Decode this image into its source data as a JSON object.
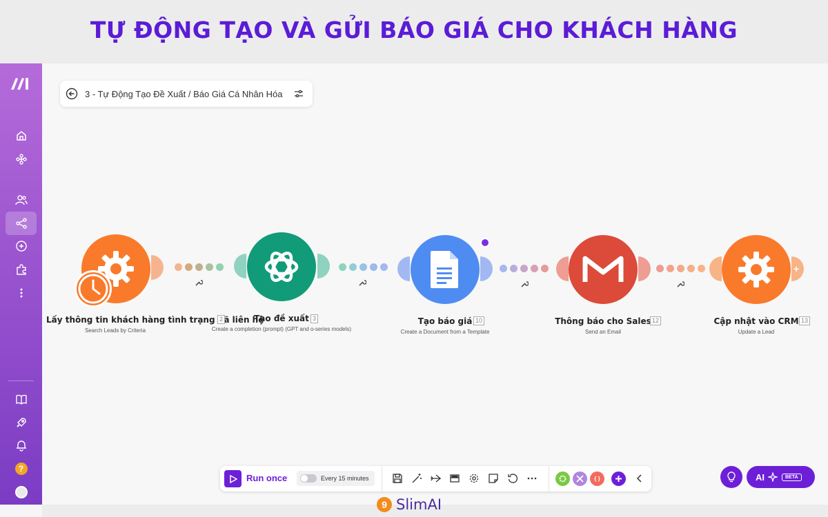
{
  "banner": {
    "title": "TỰ ĐỘNG TẠO VÀ GỬI BÁO GIÁ CHO KHÁCH HÀNG"
  },
  "scenario": {
    "name": "3 - Tự Động Tạo Đề Xuất / Báo Giá Cá Nhân Hóa"
  },
  "sidebar": {
    "logo": "make-logo",
    "items": [
      {
        "icon": "home-icon"
      },
      {
        "icon": "apps-icon"
      },
      {
        "icon": "team-icon"
      },
      {
        "icon": "scenarios-icon",
        "active": true
      },
      {
        "icon": "connections-icon"
      },
      {
        "icon": "puzzle-icon"
      },
      {
        "icon": "more-vertical-icon"
      }
    ],
    "bottom": [
      {
        "icon": "book-icon"
      },
      {
        "icon": "rocket-icon"
      },
      {
        "icon": "bell-icon"
      },
      {
        "icon": "help-icon",
        "text": "?"
      },
      {
        "icon": "avatar"
      }
    ]
  },
  "modules": [
    {
      "title": "Lấy thông tin khách hàng tình trạng đã liên hệ",
      "subtitle": "Search Leads by Criteria",
      "index": "2",
      "color": "#f97a2b",
      "icon": "gear-icon"
    },
    {
      "title": "Tạo đề xuất",
      "subtitle": "Create a completion (prompt) (GPT and o-series models)",
      "index": "3",
      "color": "#129b78",
      "icon": "openai-icon"
    },
    {
      "title": "Tạo báo giá",
      "subtitle": "Create a Document from a Template",
      "index": "10",
      "color": "#4f8cf2",
      "icon": "google-docs-icon"
    },
    {
      "title": "Thông báo cho Sales",
      "subtitle": "Send an Email",
      "index": "12",
      "color": "#dc4a3a",
      "icon": "gmail-icon"
    },
    {
      "title": "Cập nhật vào CRM",
      "subtitle": "Update a Lead",
      "index": "13",
      "color": "#f97a2b",
      "icon": "gear-icon"
    }
  ],
  "toolbar": {
    "run_label": "Run once",
    "schedule_label": "Every 15 minutes",
    "icons": [
      "save-icon",
      "magic-wand-icon",
      "airplane-icon",
      "layout-icon",
      "settings-icon",
      "note-icon",
      "undo-icon",
      "more-horizontal-icon"
    ],
    "apps": [
      {
        "color": "#7ac943",
        "icon": "gear-icon"
      },
      {
        "color": "#b085e0",
        "icon": "tools-icon"
      },
      {
        "color": "#f26b5e",
        "icon": "bracket-icon",
        "text": "{ }"
      }
    ]
  },
  "ai": {
    "label": "AI",
    "badge": "BETA"
  },
  "brand": {
    "mark": "9",
    "name": "SlimAI"
  },
  "colors": {
    "accent": "#6d1fd8",
    "title": "#5b1cd6"
  }
}
